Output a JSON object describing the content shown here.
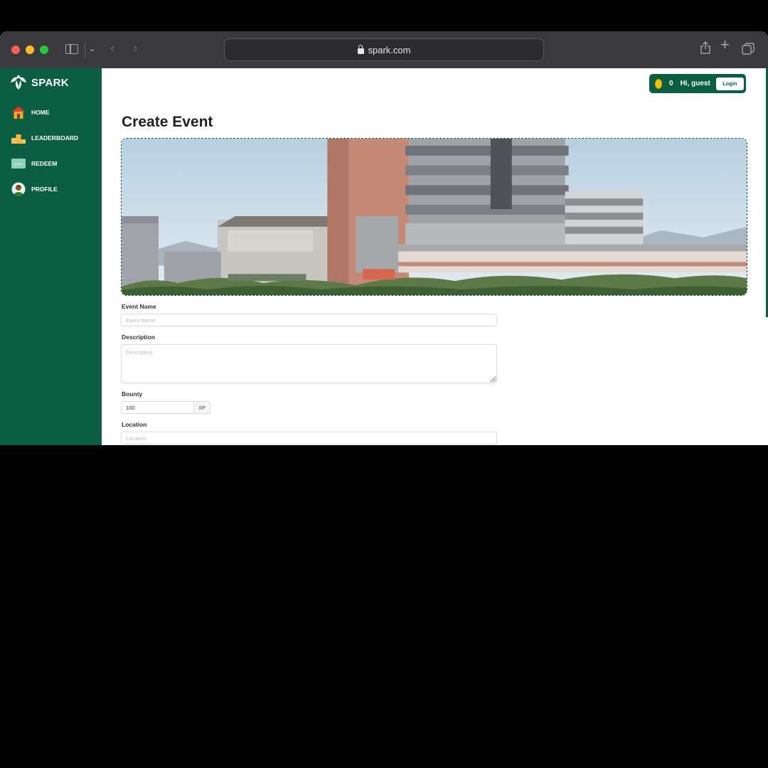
{
  "browser": {
    "url": "spark.com"
  },
  "sidebar": {
    "brand": "SPARK",
    "items": [
      {
        "label": "HOME",
        "icon": "home-icon"
      },
      {
        "label": "LEADERBOARD",
        "icon": "podium-icon"
      },
      {
        "label": "REDEEM",
        "icon": "ticket-icon"
      },
      {
        "label": "PROFILE",
        "icon": "avatar-icon"
      }
    ]
  },
  "header": {
    "xp": "0",
    "greeting": "Hi, guest",
    "login_label": "Login"
  },
  "form": {
    "title": "Create Event",
    "event_name": {
      "label": "Event Name",
      "placeholder": "Event Name",
      "value": ""
    },
    "description": {
      "label": "Description",
      "placeholder": "Description",
      "value": ""
    },
    "bounty": {
      "label": "Bounty",
      "value": "100",
      "unit": "XP"
    },
    "location": {
      "label": "Location",
      "placeholder": "Location",
      "value": ""
    }
  },
  "colors": {
    "brand_green": "#0b5e42",
    "coin": "#f4c20d"
  }
}
